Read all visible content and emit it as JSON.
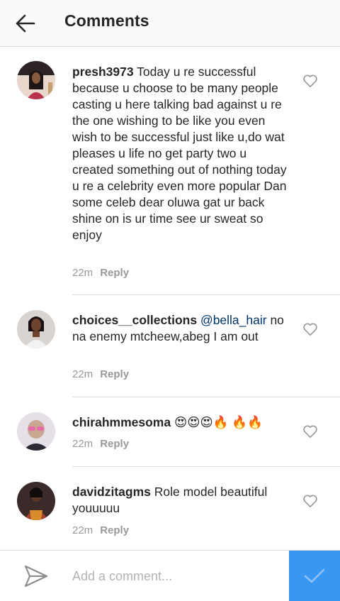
{
  "header": {
    "title": "Comments"
  },
  "comments": [
    {
      "username": "presh3973",
      "text": " Today u re successful because u choose to be many people casting u here talking bad against u re the one wishing to be like you even wish to be successful just like u,do wat pleases u life no get party two u created something out of nothing today u re a celebrity even more popular Dan some celeb dear oluwa gat ur back shine on is ur time see ur sweat so enjoy",
      "time": "22m",
      "reply": "Reply"
    },
    {
      "username": "choices__collections",
      "mention": " @bella_hair",
      "text": " no na enemy  mtcheew,abeg I am out",
      "time": "22m",
      "reply": "Reply"
    },
    {
      "username": "chirahmmesoma",
      "text": " 😍😍😍🔥 🔥🔥",
      "time": "22m",
      "reply": "Reply"
    },
    {
      "username": "davidzitagms",
      "text": " Role model beautiful youuuuu",
      "time": "22m",
      "reply": "Reply"
    }
  ],
  "footer": {
    "placeholder": "Add a comment..."
  },
  "colors": {
    "accent": "#3897f0",
    "username": "#262626",
    "meta": "#999999",
    "divider": "#dbdbdb"
  }
}
